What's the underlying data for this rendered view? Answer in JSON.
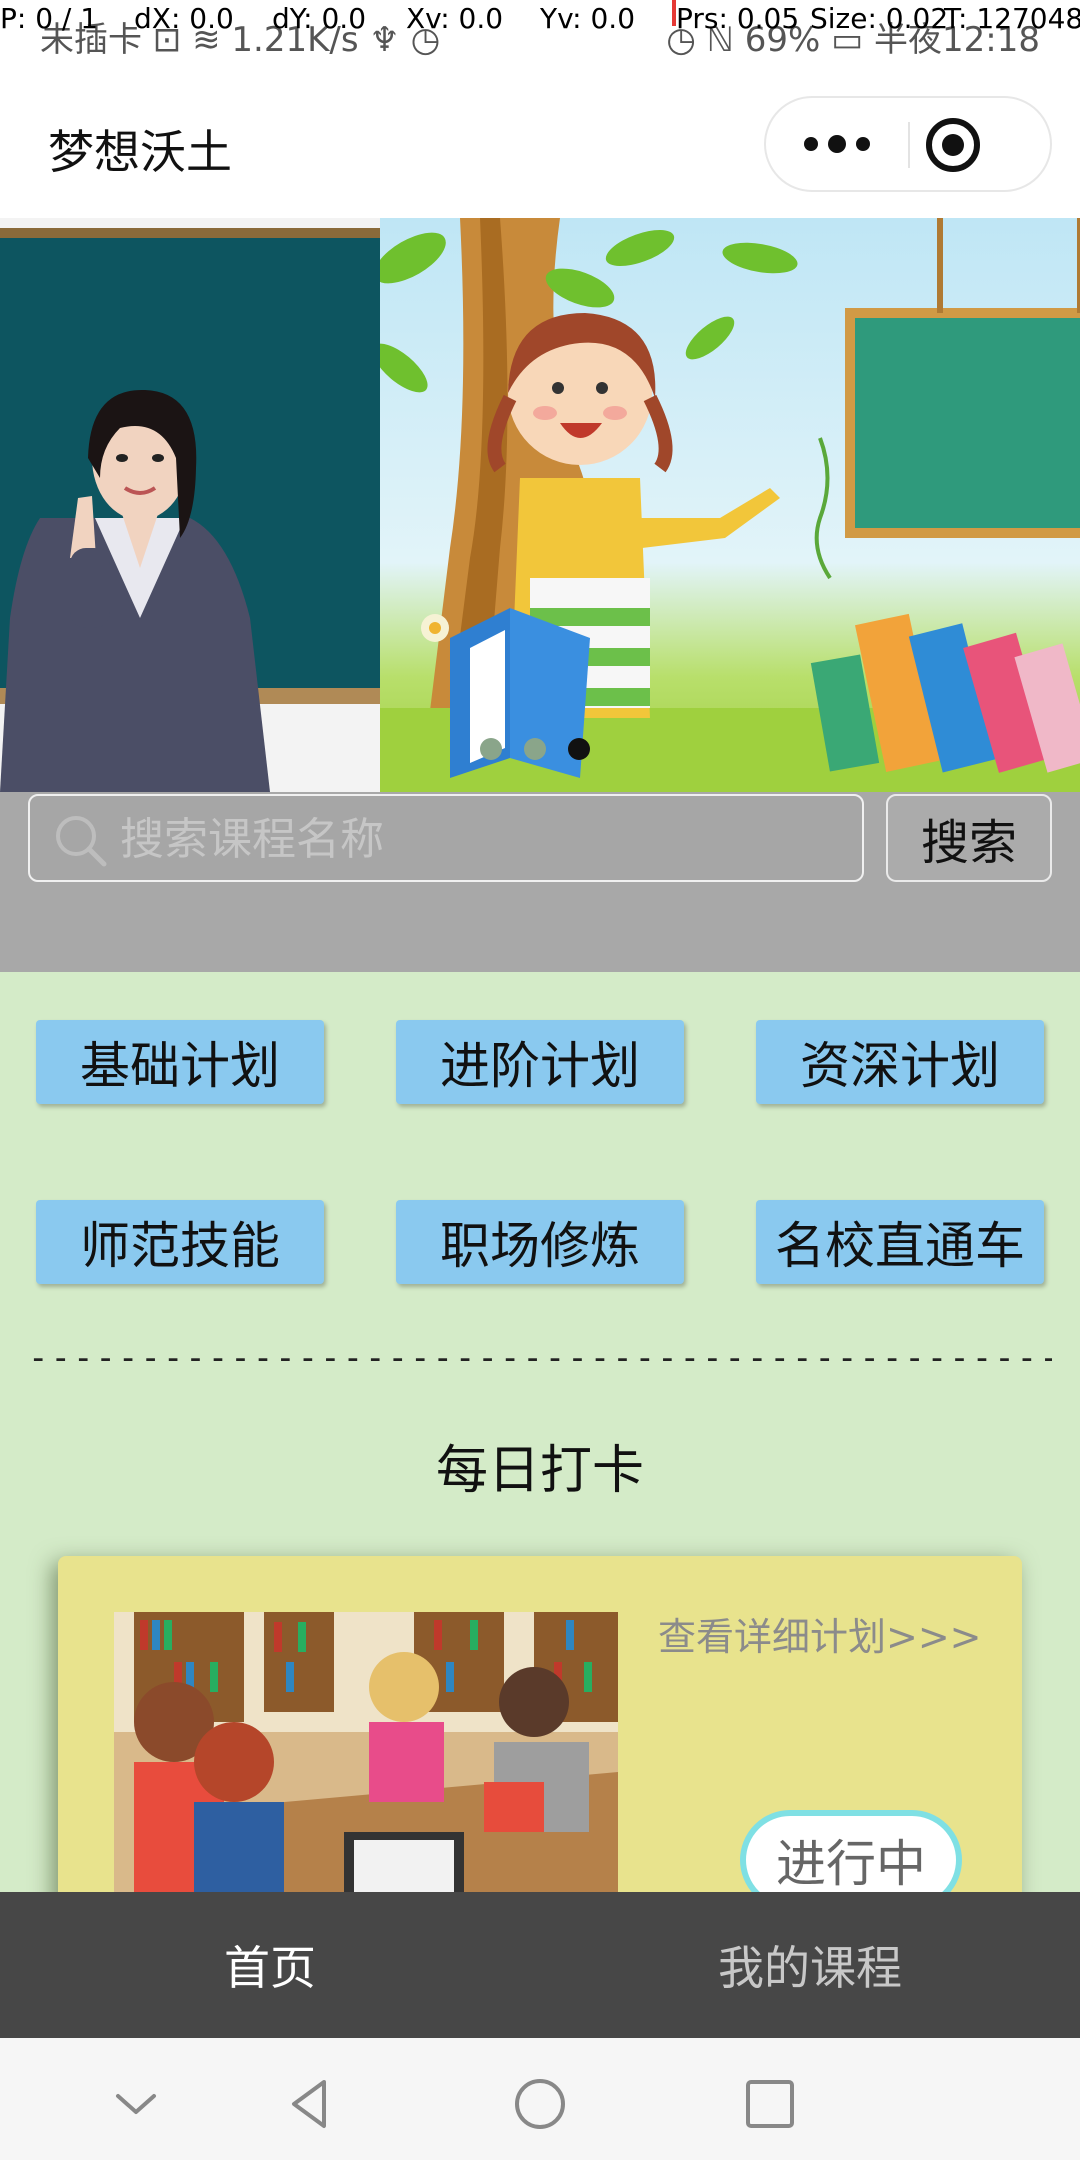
{
  "status_bar": {
    "left_text": "未插卡 ⊡ ≋ 1.21K/s ♆ ◷",
    "right_text": "◷ ℕ 69% ▭ 半夜12:18"
  },
  "debug": {
    "p": "P: 0 / 1",
    "dx": "dX: 0.0",
    "dy": "dY: 0.0",
    "xv": "Xv: 0.0",
    "yv": "Yv: 0.0",
    "prs": "Prs: 0.05",
    "size": "Size: 0.02",
    "t": "T: 127048"
  },
  "header": {
    "title": "梦想沃土"
  },
  "banner": {
    "slides": 3,
    "active_index": 2
  },
  "search": {
    "placeholder": "搜索课程名称",
    "button_label": "搜索"
  },
  "plans": [
    "基础计划",
    "进阶计划",
    "资深计划",
    "师范技能",
    "职场修炼",
    "名校直通车"
  ],
  "divider_text": "----------------------------------------------",
  "checkin": {
    "section_title": "每日打卡",
    "detail_link": "查看详细计划>>>",
    "status": "进行中"
  },
  "tabbar": {
    "home": "首页",
    "my_courses": "我的课程"
  },
  "colors": {
    "page_bg": "#d4ebc8",
    "plan_button": "#8ac9ef",
    "card_bg": "#e8e38d",
    "tabbar_bg": "#474747",
    "pill_border": "#7fe0e4"
  }
}
